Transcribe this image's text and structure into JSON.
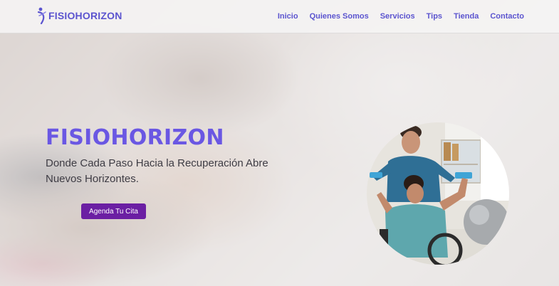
{
  "brand": {
    "name": "FISIOHORIZON",
    "logo_color": "#5b54cf"
  },
  "nav": {
    "items": [
      "Inicio",
      "Quienes Somos",
      "Servicios",
      "Tips",
      "Tienda",
      "Contacto"
    ]
  },
  "hero": {
    "title": "FISIOHORIZON",
    "subtitle": "Donde Cada Paso Hacia la Recuperación Abre Nuevos Horizontes.",
    "cta_label": "Agenda Tu Cita",
    "accent": "#6a57e3",
    "cta_color": "#6b1fa3",
    "background_image": "physiotherapy-hands-icon",
    "photo": "therapist-with-patient-dumbbells-icon"
  }
}
